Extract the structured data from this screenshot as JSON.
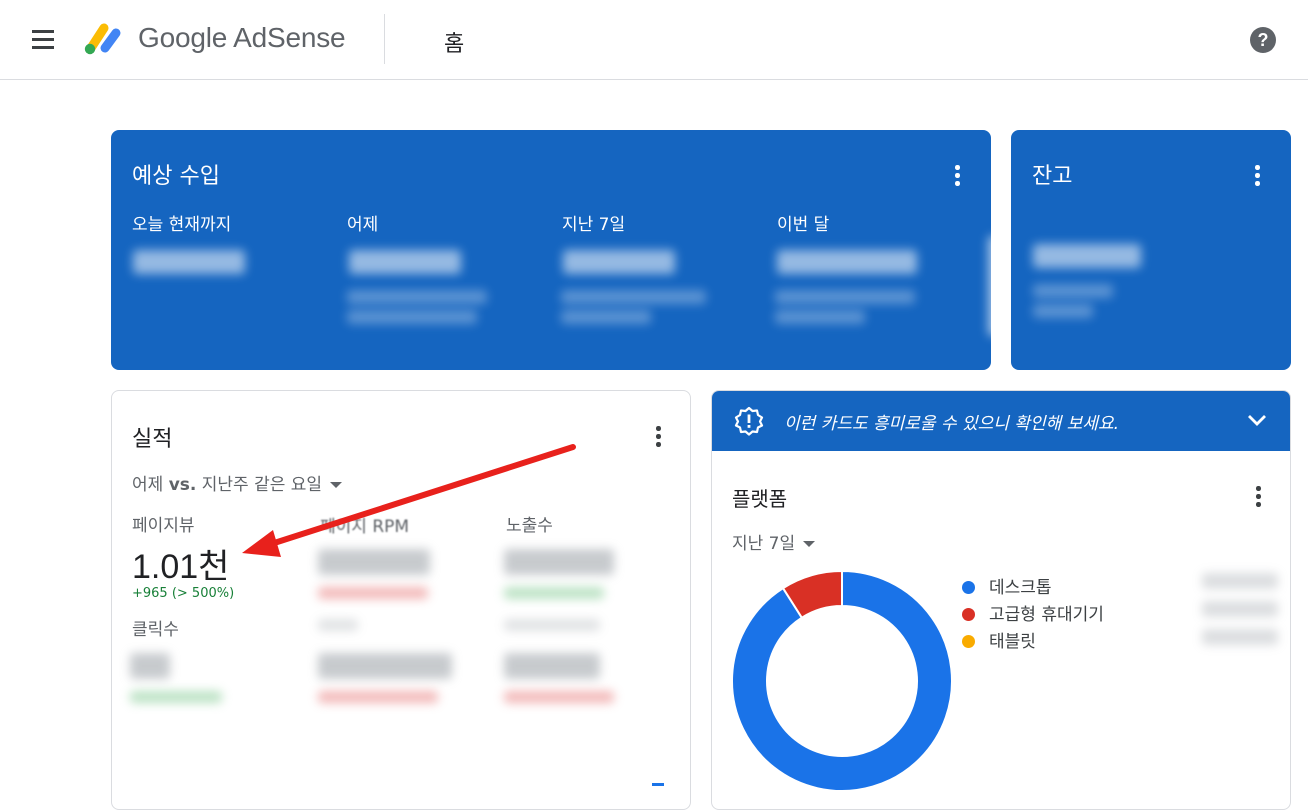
{
  "header": {
    "brand": "Google AdSense",
    "page_title": "홈",
    "help_symbol": "?"
  },
  "estimated_earnings": {
    "title": "예상 수입",
    "columns": [
      "오늘 현재까지",
      "어제",
      "지난 7일",
      "이번 달"
    ]
  },
  "balance": {
    "title": "잔고"
  },
  "performance": {
    "title": "실적",
    "compare_prefix": "어제",
    "compare_vs": "vs.",
    "compare_suffix": "지난주 같은 요일",
    "metrics": {
      "pageviews_label": "페이지뷰",
      "pageviews_value": "1.01천",
      "pageviews_change": "+965 (> 500%)",
      "page_rpm_label": "페이지 RPM",
      "impressions_label": "노출수",
      "clicks_label": "클릭수"
    }
  },
  "recommendation": {
    "banner_text": "이런 카드도 흥미로울 수 있으니 확인해 보세요."
  },
  "platform": {
    "title": "플랫폼",
    "range": "지난 7일",
    "legend": [
      {
        "label": "데스크톱",
        "color": "#1a73e8"
      },
      {
        "label": "고급형 휴대기기",
        "color": "#d93025"
      },
      {
        "label": "태블릿",
        "color": "#f9ab00"
      }
    ],
    "chart_data": {
      "type": "pie",
      "labels": [
        "데스크톱",
        "고급형 휴대기기",
        "태블릿"
      ],
      "values": [
        91,
        9,
        0
      ]
    }
  },
  "colors": {
    "accent_blue": "#1565c0",
    "positive_green": "#188038",
    "annotation_red": "#e8211c"
  },
  "annotation": {
    "arrow": "red-arrow pointing to pageviews value"
  }
}
